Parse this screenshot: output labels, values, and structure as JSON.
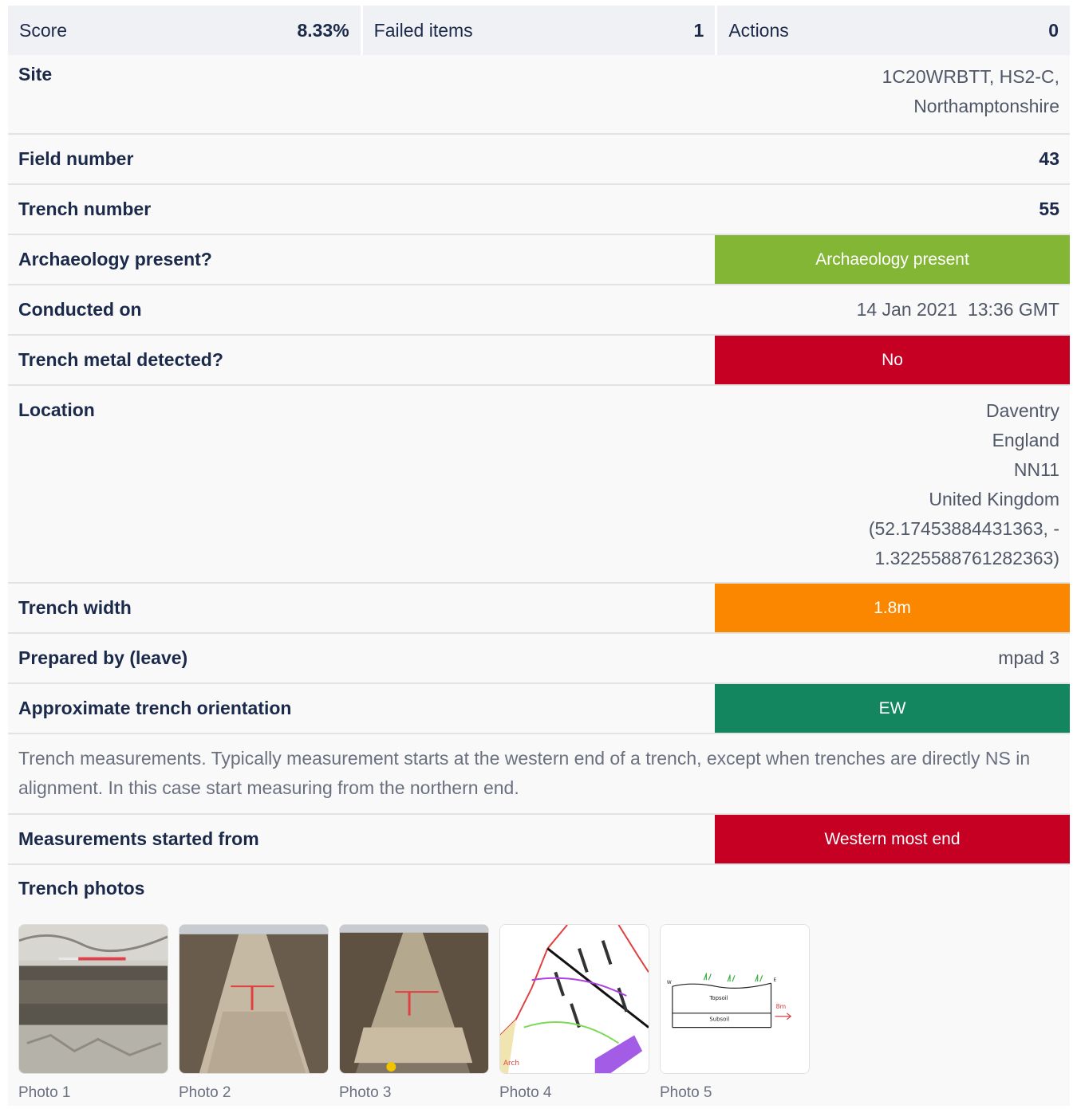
{
  "summary": {
    "score_label": "Score",
    "score_value": "8.33%",
    "failed_label": "Failed items",
    "failed_value": "1",
    "actions_label": "Actions",
    "actions_value": "0"
  },
  "fields": {
    "site": {
      "label": "Site",
      "value_line1": "1C20WRBTT, HS2-C,",
      "value_line2": "Northamptonshire"
    },
    "field_number": {
      "label": "Field number",
      "value": "43"
    },
    "trench_number": {
      "label": "Trench number",
      "value": "55"
    },
    "archaeology": {
      "label": "Archaeology present?",
      "value": "Archaeology present",
      "color": "#84b636"
    },
    "conducted": {
      "label": "Conducted on",
      "value": "14 Jan 2021  13:36 GMT"
    },
    "metal": {
      "label": "Trench metal detected?",
      "value": "No",
      "color": "#c60022"
    },
    "location": {
      "label": "Location",
      "line1": "Daventry",
      "line2": "England",
      "line3": "NN11",
      "line4": "United Kingdom",
      "line5": "(52.17453884431363, -",
      "line6": "1.3225588761282363)"
    },
    "width": {
      "label": "Trench width",
      "value": "1.8m",
      "color": "#fb8700"
    },
    "prepared": {
      "label": "Prepared by (leave)",
      "value": "mpad 3"
    },
    "orientation": {
      "label": "Approximate trench orientation",
      "value": "EW",
      "color": "#13855f"
    },
    "note": "Trench measurements. Typically measurement starts at the western end of a trench, except when trenches are directly NS in alignment. In this case start measuring from the northern end.",
    "measurements": {
      "label": "Measurements started from",
      "value": "Western most end",
      "color": "#c60022"
    }
  },
  "photos": {
    "title": "Trench photos",
    "captions": [
      "Photo 1",
      "Photo 2",
      "Photo 3",
      "Photo 4",
      "Photo 5"
    ],
    "sketch_labels": {
      "topsoil": "Topsoil",
      "subsoil": "Subsoil",
      "length": "8m",
      "west": "W",
      "east": "E",
      "arch": "Arch"
    }
  }
}
